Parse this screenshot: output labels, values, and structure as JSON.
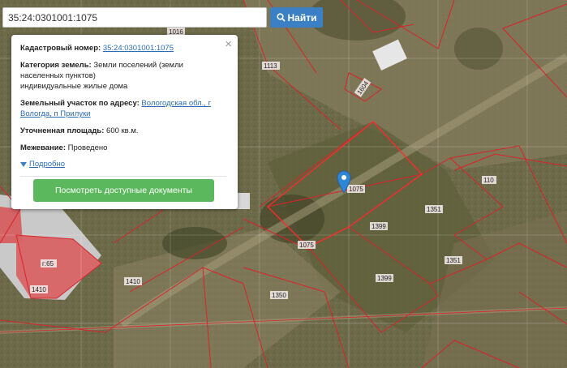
{
  "search": {
    "value": "35:24:0301001:1075",
    "button_label": "Найти"
  },
  "popup": {
    "cadastral_label": "Кадастровый номер:",
    "cadastral_value": "35:24:0301001:1075",
    "category_label": "Категория земель:",
    "category_value_line1": "Земли поселений (земли",
    "category_value_line2": "населенных пунктов)",
    "category_value_line3": "индивидуальные жилые дома",
    "address_label": "Земельный участок по адресу:",
    "address_value_line1": "Вологодская обл., г",
    "address_value_line2": "Вологда, п Прилуки",
    "area_label": "Уточненная площадь:",
    "area_value": "600 кв.м.",
    "survey_label": "Межевание:",
    "survey_value": "Проведено",
    "details_label": "Подробно",
    "docs_button": "Посмотреть доступные документы"
  },
  "map": {
    "parcel_labels": {
      "p1016": "1016",
      "p1113": "1113",
      "p1604": "1604",
      "p1075a": "1075",
      "p1075b": "1075",
      "p1399a": "1399",
      "p1399b": "1399",
      "p1351a": "1351",
      "p1351b": "1351",
      "p110": "110",
      "p1410a": "1410",
      "p1410b": "1410",
      "p1350": "1350",
      "p665": "г:65"
    },
    "boundary_color": "#d8232a",
    "marker_color": "#2f86d6"
  }
}
